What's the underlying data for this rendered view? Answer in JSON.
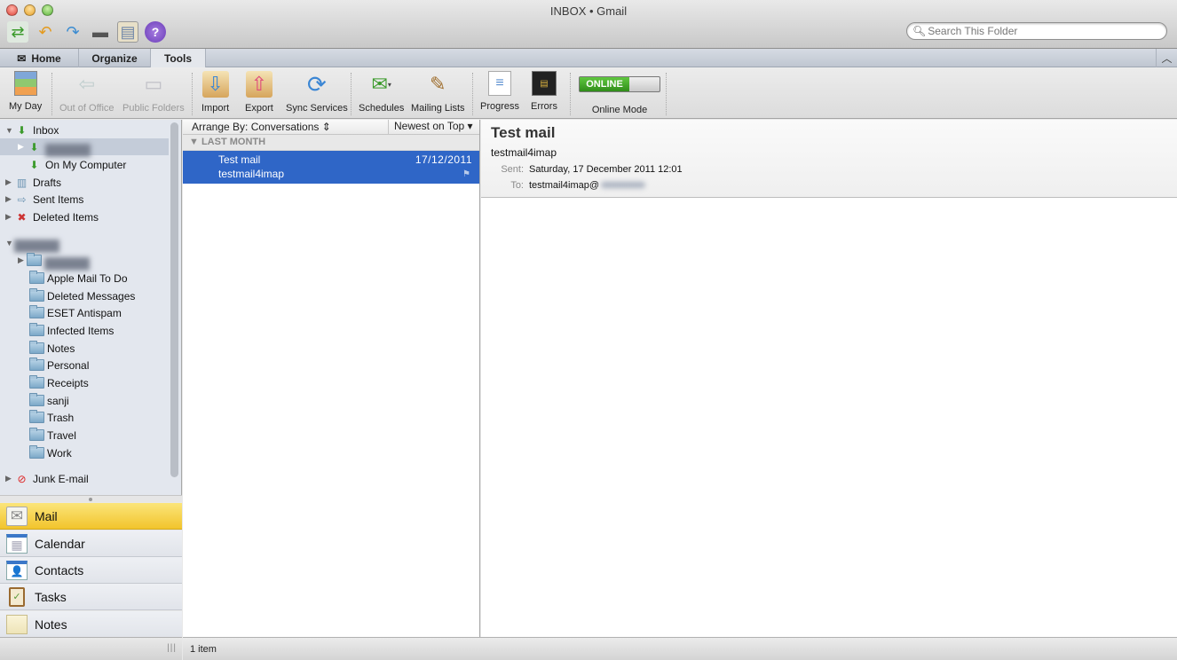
{
  "window": {
    "title": "INBOX • Gmail"
  },
  "quick_access": [
    {
      "name": "send-receive-icon",
      "glyph": "⇄"
    },
    {
      "name": "undo-icon",
      "glyph": "↶"
    },
    {
      "name": "redo-icon",
      "glyph": "↷"
    },
    {
      "name": "print-icon",
      "glyph": "🖶"
    },
    {
      "name": "my-day-icon",
      "glyph": "▤"
    },
    {
      "name": "help-icon",
      "glyph": "?"
    }
  ],
  "search": {
    "placeholder": "Search This Folder",
    "value": ""
  },
  "tabs": [
    {
      "label": "Home",
      "icon": "✉"
    },
    {
      "label": "Organize"
    },
    {
      "label": "Tools",
      "active": true
    }
  ],
  "ribbon": {
    "buttons": [
      {
        "label": "My Day",
        "glyph": "▤",
        "enabled": true
      },
      {
        "label": "Out of Office",
        "glyph": "🚪",
        "enabled": false
      },
      {
        "label": "Public Folders",
        "glyph": "🗂",
        "enabled": false
      },
      {
        "label": "Import",
        "glyph": "📥",
        "enabled": true
      },
      {
        "label": "Export",
        "glyph": "📤",
        "enabled": true
      },
      {
        "label": "Sync Services",
        "glyph": "⟳",
        "enabled": true
      },
      {
        "label": "Schedules",
        "glyph": "✉",
        "enabled": true
      },
      {
        "label": "Mailing Lists",
        "glyph": "📝",
        "enabled": true
      },
      {
        "label": "Progress",
        "glyph": "▦",
        "enabled": true
      },
      {
        "label": "Errors",
        "glyph": "▣",
        "enabled": true
      },
      {
        "label": "Online Mode",
        "enabled": true
      }
    ],
    "online_toggle": {
      "state": "ONLINE"
    }
  },
  "folders": {
    "inbox": {
      "label": "Inbox"
    },
    "account_inbox": {
      "label": "██████"
    },
    "on_my_computer": {
      "label": "On My Computer"
    },
    "drafts": {
      "label": "Drafts"
    },
    "sent": {
      "label": "Sent Items"
    },
    "deleted": {
      "label": "Deleted Items"
    },
    "account": {
      "label": "██████"
    },
    "account_sub": {
      "label": "██████"
    },
    "subfolders": [
      "Apple Mail To Do",
      "Deleted Messages",
      "ESET Antispam",
      "Infected Items",
      "Notes",
      "Personal",
      "Receipts",
      "sanji",
      "Trash",
      "Travel",
      "Work"
    ],
    "junk": {
      "label": "Junk E-mail"
    }
  },
  "nav": [
    {
      "label": "Mail",
      "glyph": "✉",
      "active": true
    },
    {
      "label": "Calendar",
      "glyph": "▦"
    },
    {
      "label": "Contacts",
      "glyph": "👤"
    },
    {
      "label": "Tasks",
      "glyph": "📋"
    },
    {
      "label": "Notes",
      "glyph": "▭"
    }
  ],
  "message_list": {
    "arrange_by": "Arrange By: Conversations ⇕",
    "sort": "Newest on Top ▾",
    "group": "▼ LAST MONTH",
    "messages": [
      {
        "subject": "Test mail",
        "from": "testmail4imap",
        "date": "17/12/2011",
        "selected": true
      }
    ]
  },
  "reader": {
    "subject": "Test mail",
    "from": "testmail4imap",
    "sent_label": "Sent:",
    "sent_value": "Saturday, 17 December 2011 12:01",
    "to_label": "To:",
    "to_value": "testmail4imap@"
  },
  "status": {
    "count": "1 item"
  }
}
